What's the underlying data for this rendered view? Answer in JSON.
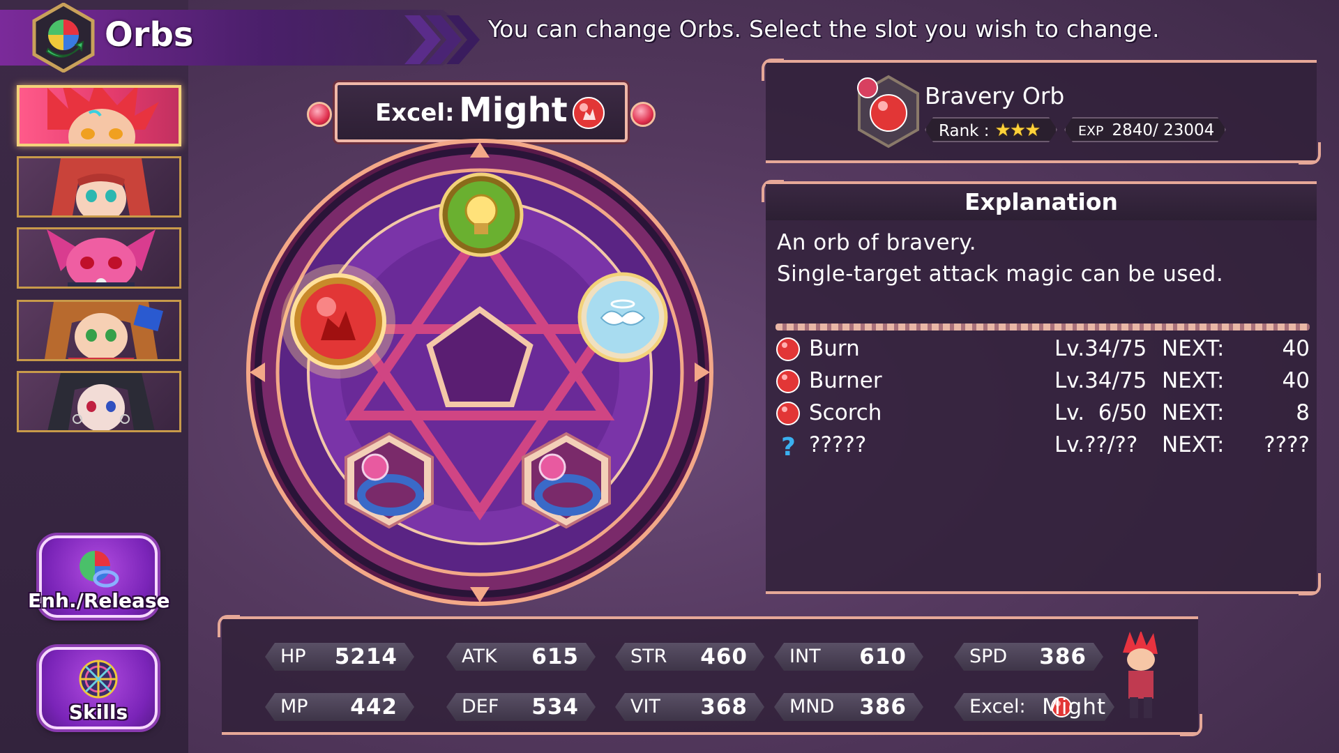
{
  "header": {
    "title": "Orbs",
    "instruction": "You can change Orbs. Select the slot you wish to change."
  },
  "party": [
    {
      "label": "",
      "selected": true,
      "hair": "#e8333f",
      "skin": "#f6c6a6"
    },
    {
      "label": "",
      "selected": false,
      "hair": "#c9433a",
      "skin": "#f7d2bc"
    },
    {
      "label": "",
      "selected": false,
      "hair": "#d93c8f",
      "skin": "#ef5ea2"
    },
    {
      "label": "",
      "selected": false,
      "hair": "#b86a2e",
      "skin": "#f6d0b4"
    },
    {
      "label": "",
      "selected": false,
      "hair": "#2b2b36",
      "skin": "#f2dcd6"
    }
  ],
  "menu": {
    "enhance_label": "Enh./Release",
    "skills_label": "Skills"
  },
  "excel_banner": {
    "label": "Excel:",
    "value": "Might"
  },
  "circle": {
    "slots": [
      {
        "name": "light-bulb-orb",
        "color": "#d8b12a"
      },
      {
        "name": "bravery-orb",
        "color": "#e23636",
        "selected": true
      },
      {
        "name": "wing-orb",
        "color": "#9fd8f0"
      },
      {
        "name": "ring-accessory-left",
        "color": "#3a6ac8"
      },
      {
        "name": "ring-accessory-right",
        "color": "#3a6ac8"
      }
    ]
  },
  "orb": {
    "name": "Bravery Orb",
    "rank_label": "Rank :",
    "rank_stars": "★★★",
    "exp_label": "EXP",
    "exp_value": "2840/ 23004"
  },
  "explanation": {
    "title": "Explanation",
    "line1": "An orb of bravery.",
    "line2": "Single-target attack magic can be used.",
    "skills": [
      {
        "name": "Burn",
        "lv": "Lv.34/75",
        "next_label": "NEXT:",
        "next": "40",
        "icon": "fire-orb-icon"
      },
      {
        "name": "Burner",
        "lv": "Lv.34/75",
        "next_label": "NEXT:",
        "next": "40",
        "icon": "fire-orb-icon"
      },
      {
        "name": "Scorch",
        "lv": "Lv.  6/50",
        "next_label": "NEXT:",
        "next": "8",
        "icon": "fire-orb-icon"
      },
      {
        "name": "?????",
        "lv": "Lv.??/??",
        "next_label": "NEXT:",
        "next": "????",
        "icon": "question-icon"
      }
    ]
  },
  "stats": {
    "hp": {
      "k": "HP",
      "v": "5214"
    },
    "atk": {
      "k": "ATK",
      "v": "615"
    },
    "str": {
      "k": "STR",
      "v": "460"
    },
    "int": {
      "k": "INT",
      "v": "610"
    },
    "spd": {
      "k": "SPD",
      "v": "386"
    },
    "mp": {
      "k": "MP",
      "v": "442"
    },
    "def": {
      "k": "DEF",
      "v": "534"
    },
    "vit": {
      "k": "VIT",
      "v": "368"
    },
    "mnd": {
      "k": "MND",
      "v": "386"
    },
    "excel": {
      "k": "Excel:",
      "v": "Might"
    }
  },
  "colors": {
    "accent": "#e6a898",
    "header": "#7b2a9a",
    "fire": "#e23636"
  }
}
